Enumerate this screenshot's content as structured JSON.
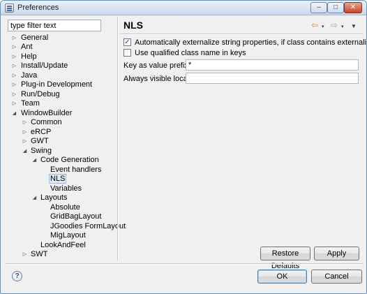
{
  "window": {
    "title": "Preferences",
    "controls": {
      "minimize": "‒",
      "maximize": "□",
      "close": "✕"
    }
  },
  "filter": {
    "placeholder": "type filter text",
    "value": "type filter text"
  },
  "tree": [
    {
      "label": "General",
      "arrow": "▷"
    },
    {
      "label": "Ant",
      "arrow": "▷"
    },
    {
      "label": "Help",
      "arrow": "▷"
    },
    {
      "label": "Install/Update",
      "arrow": "▷"
    },
    {
      "label": "Java",
      "arrow": "▷"
    },
    {
      "label": "Plug-in Development",
      "arrow": "▷"
    },
    {
      "label": "Run/Debug",
      "arrow": "▷"
    },
    {
      "label": "Team",
      "arrow": "▷"
    },
    {
      "label": "WindowBuilder",
      "arrow": "◢"
    },
    {
      "label": "Common",
      "arrow": "▷"
    },
    {
      "label": "eRCP",
      "arrow": "▷"
    },
    {
      "label": "GWT",
      "arrow": "▷"
    },
    {
      "label": "Swing",
      "arrow": "◢"
    },
    {
      "label": "Code Generation",
      "arrow": "◢"
    },
    {
      "label": "Event handlers",
      "arrow": ""
    },
    {
      "label": "NLS",
      "arrow": "",
      "selected": true
    },
    {
      "label": "Variables",
      "arrow": ""
    },
    {
      "label": "Layouts",
      "arrow": "◢"
    },
    {
      "label": "Absolute",
      "arrow": ""
    },
    {
      "label": "GridBagLayout",
      "arrow": ""
    },
    {
      "label": "JGoodies FormLayout",
      "arrow": ""
    },
    {
      "label": "MigLayout",
      "arrow": ""
    },
    {
      "label": "LookAndFeel",
      "arrow": ""
    },
    {
      "label": "SWT",
      "arrow": "▷"
    }
  ],
  "page": {
    "title": "NLS",
    "nav": {
      "back": "⇦",
      "forward": "⇨",
      "dropdown": "▾",
      "menu": "▼"
    },
    "checkboxes": [
      {
        "label": "Automatically externalize string properties, if class contains externalized properties",
        "checked": true,
        "mark": "✓"
      },
      {
        "label": "Use qualified class name in keys",
        "checked": false,
        "mark": ""
      }
    ],
    "fields": [
      {
        "label": "Key as value prefix:",
        "value": "*"
      },
      {
        "label": "Always visible locales:",
        "value": ""
      }
    ],
    "restore_defaults": "Restore Defaults",
    "apply": "Apply"
  },
  "footer": {
    "help": "?",
    "ok": "OK",
    "cancel": "Cancel"
  }
}
